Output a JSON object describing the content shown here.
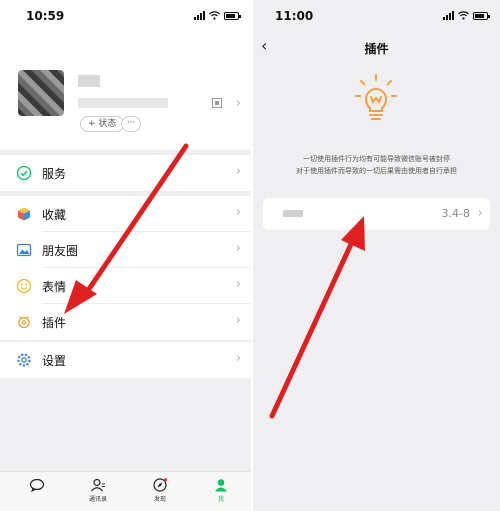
{
  "left_screen": {
    "status_time": "10:59",
    "profile": {
      "status_button": "+ 状态",
      "more_button": "···"
    },
    "menu": [
      {
        "label": "服务",
        "icon": "service-icon"
      },
      {
        "label": "收藏",
        "icon": "favorites-icon"
      },
      {
        "label": "朋友圈",
        "icon": "moments-icon"
      },
      {
        "label": "表情",
        "icon": "stickers-icon"
      },
      {
        "label": "插件",
        "icon": "plugin-icon"
      },
      {
        "label": "设置",
        "icon": "settings-icon"
      }
    ],
    "tabbar": [
      {
        "label": "",
        "icon": "chat-icon"
      },
      {
        "label": "通讯录",
        "icon": "contacts-icon"
      },
      {
        "label": "发现",
        "icon": "discover-icon"
      },
      {
        "label": "我",
        "icon": "me-icon"
      }
    ]
  },
  "right_screen": {
    "status_time": "11:00",
    "title": "插件",
    "notice_line1": "一切使用插件行为均有可能导致微信账号被封停",
    "notice_line2": "对于使用插件而导致的一切后果需由使用者自行承担",
    "plugin_version": "3.4-8"
  },
  "colors": {
    "accent_green": "#07c160",
    "annotation_red": "#e02020",
    "bulb_orange": "#f0a040"
  }
}
